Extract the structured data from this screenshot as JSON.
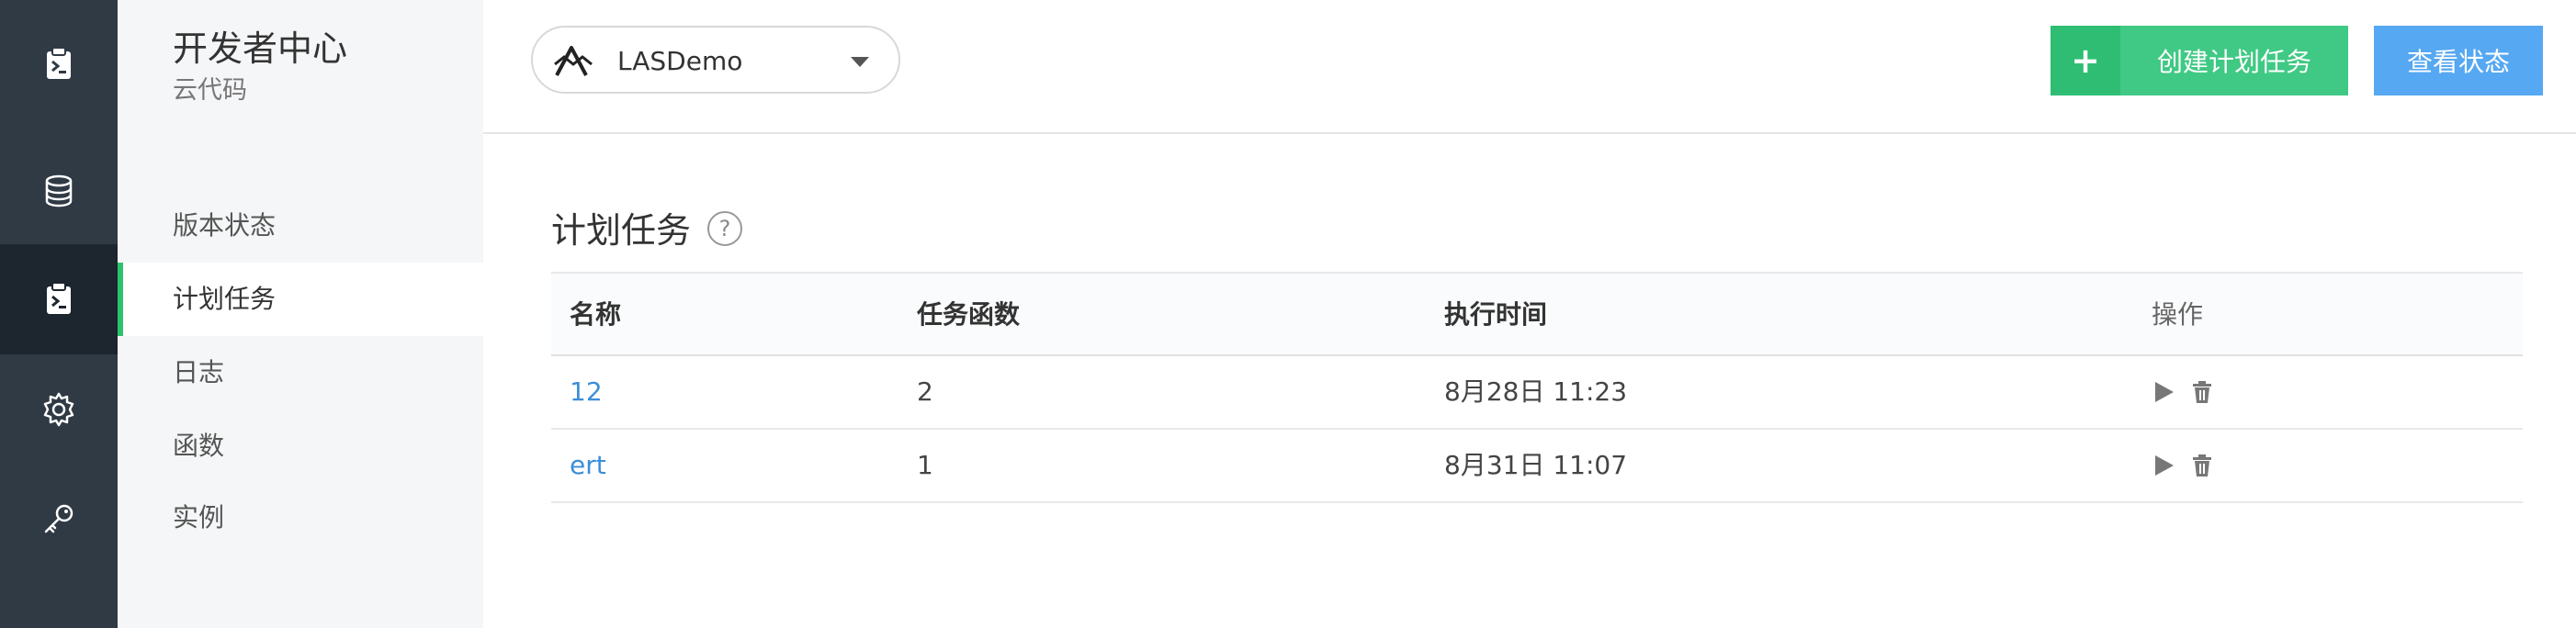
{
  "rail": {
    "items": [
      {
        "icon": "cloud-code-icon",
        "active": false
      },
      {
        "icon": "database-icon",
        "active": false
      },
      {
        "icon": "cloud-code-icon",
        "active": true
      },
      {
        "icon": "gear-icon",
        "active": false
      },
      {
        "icon": "key-icon",
        "active": false
      }
    ]
  },
  "sidebar": {
    "title": "开发者中心",
    "subtitle": "云代码",
    "items": [
      {
        "label": "版本状态"
      },
      {
        "label": "计划任务"
      },
      {
        "label": "日志"
      },
      {
        "label": "函数"
      },
      {
        "label": "实例"
      }
    ],
    "active_index": 1
  },
  "topbar": {
    "app_name": "LASDemo",
    "create_plus": "+",
    "create_label": "创建计划任务",
    "status_label": "查看状态"
  },
  "main": {
    "title": "计划任务",
    "help_symbol": "?",
    "columns": [
      "名称",
      "任务函数",
      "执行时间",
      "操作"
    ],
    "rows": [
      {
        "name": "12",
        "function": "2",
        "time": "8月28日 11:23"
      },
      {
        "name": "ert",
        "function": "1",
        "time": "8月31日 11:07"
      }
    ]
  },
  "colors": {
    "rail_bg": "#303a45",
    "accent_green": "#40c984",
    "accent_blue": "#56a8f2",
    "link_blue": "#3b8ed8"
  }
}
